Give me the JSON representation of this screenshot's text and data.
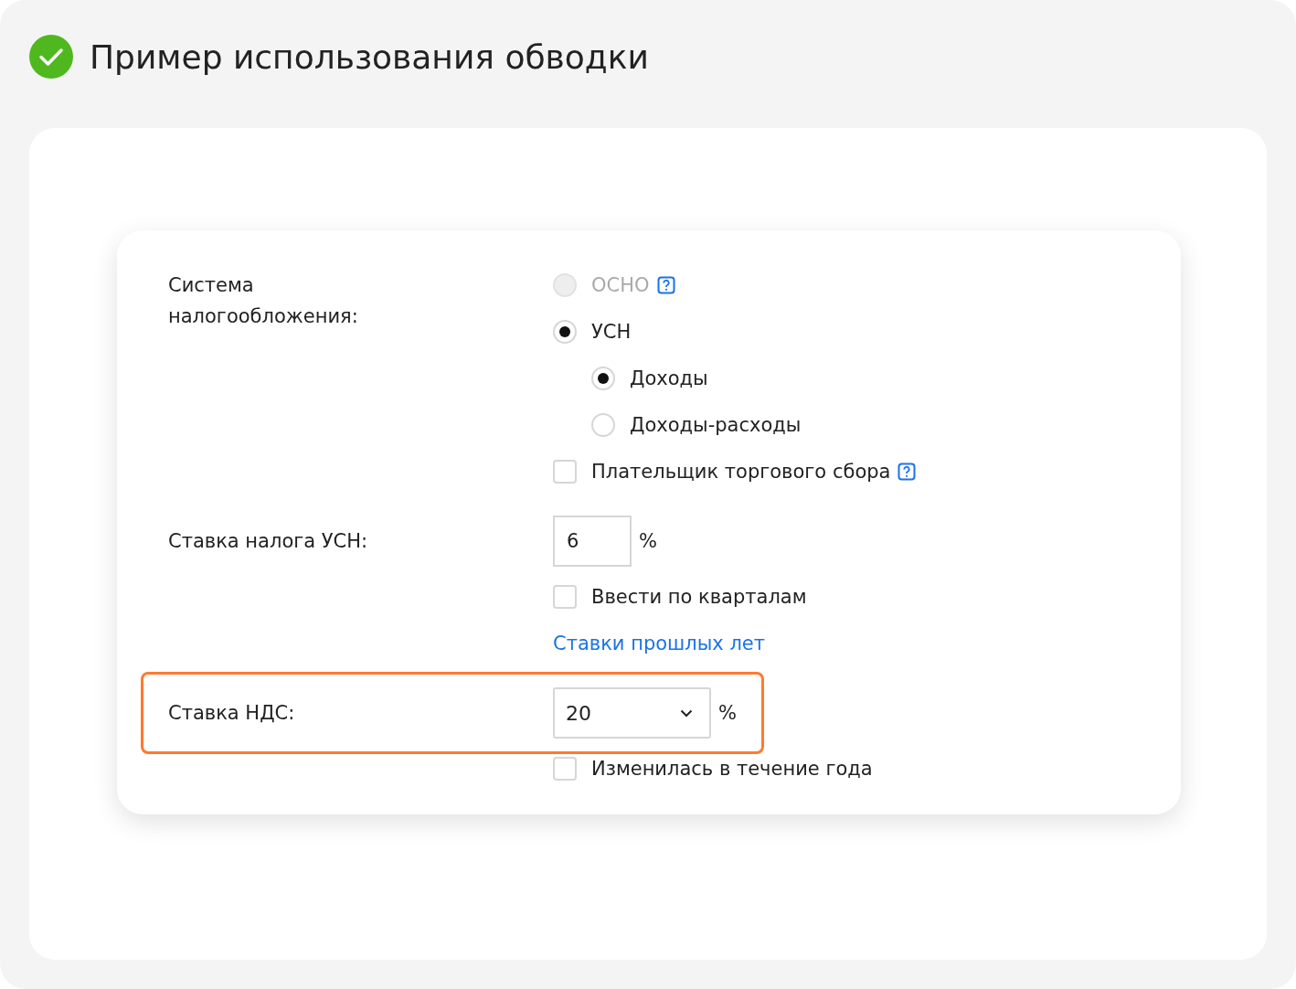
{
  "title": "Пример использования обводки",
  "rows": [
    {
      "label": "Система налогообложения:",
      "highlighted": false,
      "controls": [
        {
          "kind": "radio",
          "label": "ОСНО",
          "selected": false,
          "disabled": true,
          "help": true
        },
        {
          "kind": "radio",
          "label": "УСН",
          "selected": true,
          "disabled": false,
          "help": false,
          "children": [
            {
              "kind": "radio",
              "label": "Доходы",
              "selected": true,
              "disabled": false,
              "help": false
            },
            {
              "kind": "radio",
              "label": "Доходы-расходы",
              "selected": false,
              "disabled": false,
              "help": false
            }
          ]
        },
        {
          "kind": "checkbox",
          "label": "Плательщик торгового сбора",
          "checked": false,
          "help": true
        }
      ]
    },
    {
      "label": "Ставка налога УСН:",
      "highlighted": false,
      "controls": [
        {
          "kind": "input",
          "value": "6",
          "unit": "%"
        },
        {
          "kind": "checkbox",
          "label": "Ввести по кварталам",
          "checked": false,
          "help": false
        },
        {
          "kind": "link",
          "label": "Ставки прошлых лет"
        }
      ]
    },
    {
      "label": "Ставка НДС:",
      "highlighted": true,
      "controls": [
        {
          "kind": "select",
          "value": "20",
          "unit": "%"
        },
        {
          "kind": "checkbox",
          "label": "Изменилась в течение года",
          "checked": false,
          "help": false
        }
      ]
    }
  ]
}
